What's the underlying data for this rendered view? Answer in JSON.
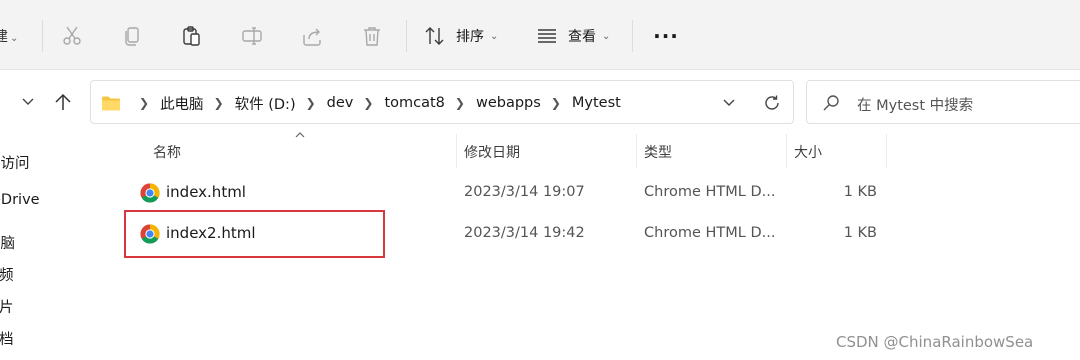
{
  "toolbar": {
    "new_label_fragment": "建",
    "sort_label": "排序",
    "view_label": "查看",
    "more_label": "···",
    "icons": [
      "cut-icon",
      "copy-icon",
      "paste-icon",
      "rename-icon",
      "share-icon",
      "delete-icon",
      "sort-icon",
      "view-icon"
    ]
  },
  "address": {
    "crumbs": [
      "此电脑",
      "软件 (D:)",
      "dev",
      "tomcat8",
      "webapps",
      "Mytest"
    ]
  },
  "search": {
    "placeholder": "在 Mytest 中搜索"
  },
  "sidebar": {
    "items": [
      "速访问",
      "eDrive",
      "电脑",
      "频",
      "片",
      "档"
    ]
  },
  "columns": {
    "name": "名称",
    "date": "修改日期",
    "type": "类型",
    "size": "大小"
  },
  "files": [
    {
      "name": "index.html",
      "date": "2023/3/14 19:07",
      "type": "Chrome HTML D...",
      "size": "1 KB",
      "icon": "chrome-icon"
    },
    {
      "name": "index2.html",
      "date": "2023/3/14 19:42",
      "type": "Chrome HTML D...",
      "size": "1 KB",
      "icon": "chrome-icon"
    }
  ],
  "watermark": "CSDN @ChinaRainbowSea",
  "colors": {
    "highlight_border": "#d9363e",
    "toolbar_bg": "#f3f3f3",
    "folder_yellow": "#f4c542"
  }
}
